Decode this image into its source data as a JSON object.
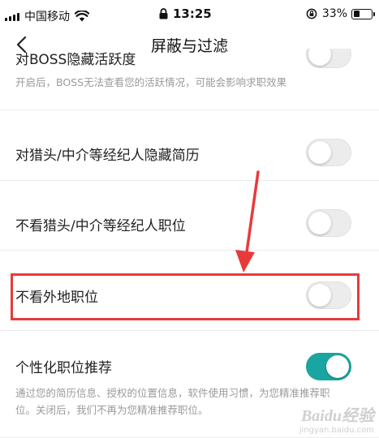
{
  "status_bar": {
    "carrier": "中国移动",
    "time": "13:25",
    "battery_percent": "33%",
    "battery_level": 0.33,
    "icons": [
      "signal-icon",
      "wifi-icon",
      "lock-icon",
      "rotation-lock-icon",
      "battery-icon"
    ]
  },
  "nav": {
    "back_icon": "chevron-left-icon",
    "title": "屏蔽与过滤"
  },
  "settings": [
    {
      "label": "对BOSS隐藏活跃度",
      "description": "开启后，BOSS无法查看您的活跃情况，可能会影响求职效果",
      "enabled": false
    },
    {
      "label": "对猎头/中介等经纪人隐藏简历",
      "enabled": false
    },
    {
      "label": "不看猎头/中介等经纪人职位",
      "enabled": false
    },
    {
      "label": "不看外地职位",
      "enabled": false
    },
    {
      "label": "个性化职位推荐",
      "description": "通过您的简历信息、授权的位置信息，软件使用习惯，为您精准推荐职位。关闭后，我们不再为您精准推荐职位。",
      "enabled": true
    }
  ],
  "colors": {
    "toggle_on": "#1aa6a0",
    "toggle_off": "#ececec",
    "annotation_red": "#e83a3a"
  },
  "watermark": {
    "logo": "Baidu经验",
    "url": "jingyan.baidu.com"
  }
}
